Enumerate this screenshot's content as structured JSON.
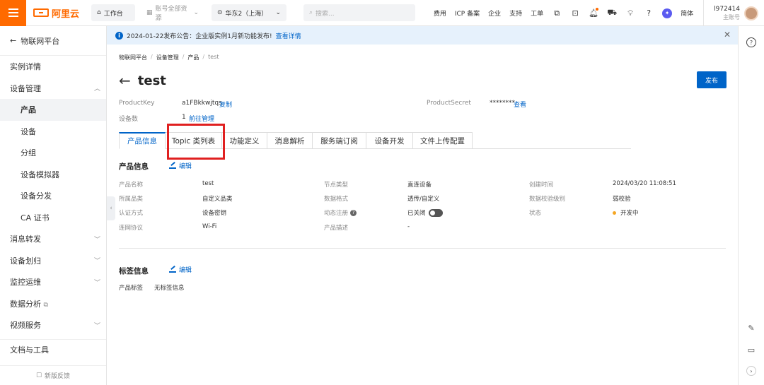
{
  "topbar": {
    "logo_text": "阿里云",
    "workbench": "工作台",
    "resources": "账号全部资源",
    "region": "华东2（上海）",
    "search_placeholder": "搜索...",
    "links": [
      "费用",
      "ICP 备案",
      "企业",
      "支持",
      "工单"
    ],
    "language": "简体",
    "account_id": "l972414",
    "account_role": "主账号"
  },
  "notice": {
    "text": "2024-01-22发布公告：企业版实例1月新功能发布!",
    "link": "查看详情"
  },
  "sidebar": {
    "back_label": "物联网平台",
    "items": [
      {
        "label": "实例详情",
        "chevron": ""
      },
      {
        "label": "设备管理",
        "chevron": "up"
      },
      {
        "label": "产品",
        "sub": true,
        "active": true
      },
      {
        "label": "设备",
        "sub": true
      },
      {
        "label": "分组",
        "sub": true
      },
      {
        "label": "设备模拟器",
        "sub": true
      },
      {
        "label": "设备分发",
        "sub": true
      },
      {
        "label": "CA 证书",
        "sub": true
      },
      {
        "label": "消息转发",
        "chevron": "down"
      },
      {
        "label": "设备划归",
        "chevron": "down"
      },
      {
        "label": "监控运维",
        "chevron": "down"
      },
      {
        "label": "数据分析",
        "chevron": "external"
      },
      {
        "label": "视频服务",
        "chevron": "down"
      },
      {
        "label": "文档与工具",
        "chevron": ""
      }
    ],
    "feedback": "新版反馈"
  },
  "breadcrumb": [
    "物联网平台",
    "设备管理",
    "产品",
    "test"
  ],
  "page": {
    "title": "test",
    "publish": "发布"
  },
  "meta": {
    "product_key_label": "ProductKey",
    "product_key_value": "a1FBkkwjtqs",
    "copy": "复制",
    "device_count_label": "设备数",
    "device_count_value": "1",
    "manage_link": "前往管理",
    "product_secret_label": "ProductSecret",
    "product_secret_value": "********",
    "view": "查看"
  },
  "tabs": [
    "产品信息",
    "Topic 类列表",
    "功能定义",
    "消息解析",
    "服务端订阅",
    "设备开发",
    "文件上传配置"
  ],
  "product_info": {
    "title": "产品信息",
    "edit": "编辑",
    "fields": {
      "name_label": "产品名称",
      "name": "test",
      "node_type_label": "节点类型",
      "node_type": "直连设备",
      "created_label": "创建时间",
      "created": "2024/03/20 11:08:51",
      "category_label": "所属品类",
      "category": "自定义品类",
      "data_format_label": "数据格式",
      "data_format": "透传/自定义",
      "verify_label": "数据校验级别",
      "verify": "弱校验",
      "auth_label": "认证方式",
      "auth": "设备密钥",
      "dynamic_label": "动态注册",
      "dynamic": "已关闭",
      "status_label": "状态",
      "status": "开发中",
      "network_label": "连网协议",
      "network": "Wi-Fi",
      "desc_label": "产品描述",
      "desc": "-"
    }
  },
  "tag_info": {
    "title": "标签信息",
    "edit": "编辑",
    "label": "产品标签",
    "value": "无标签信息"
  },
  "colors": {
    "accent": "#0064c8",
    "brand": "#ff6a00",
    "highlight": "#e02020"
  }
}
